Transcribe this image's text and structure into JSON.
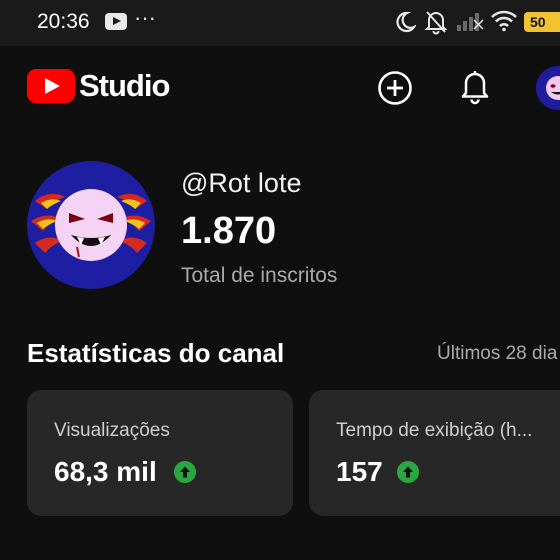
{
  "status_bar": {
    "time": "20:36",
    "more_label": "···",
    "battery": "50"
  },
  "app_bar": {
    "logo_text": "Studio",
    "create_icon": "plus-circle-icon",
    "notifications_icon": "bell-icon",
    "brand_color": "#ff0000"
  },
  "channel": {
    "handle": "@Rot lote",
    "subscriber_count": "1.870",
    "subscriber_label": "Total de inscritos"
  },
  "stats": {
    "title": "Estatísticas do canal",
    "period": "Últimos 28 dia",
    "cards": [
      {
        "label": "Visualizações",
        "value": "68,3 mil",
        "trend_icon": "arrow-up-circle-icon"
      },
      {
        "label": "Tempo de exibição (h...",
        "value": "157",
        "trend_icon": "arrow-up-circle-icon"
      }
    ],
    "trend_color": "#2ba640"
  }
}
